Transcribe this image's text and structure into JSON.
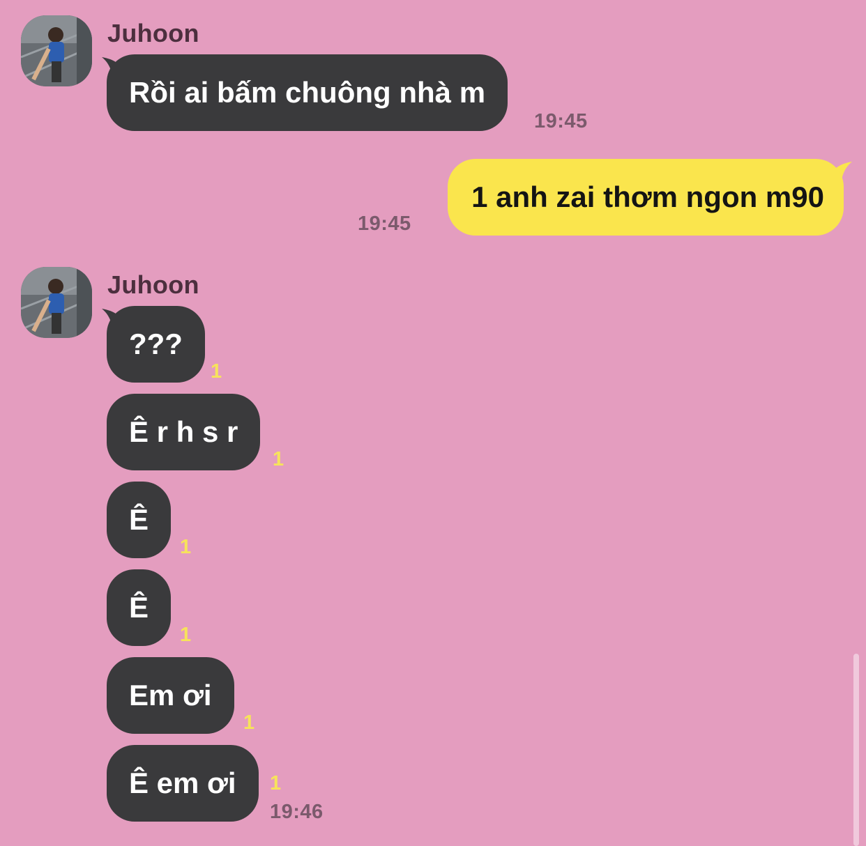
{
  "chat": {
    "contact_name": "Juhoon",
    "messages": [
      {
        "direction": "in",
        "text": "Rồi ai bấm chuông nhà m",
        "time": "19:45"
      },
      {
        "direction": "out",
        "text": "1 anh zai thơm ngon m90",
        "time": "19:45"
      },
      {
        "direction": "in",
        "text": "???",
        "unread": "1"
      },
      {
        "direction": "in",
        "text": "Ê r h s r",
        "unread": "1"
      },
      {
        "direction": "in",
        "text": "Ê",
        "unread": "1"
      },
      {
        "direction": "in",
        "text": "Ê",
        "unread": "1"
      },
      {
        "direction": "in",
        "text": "Em ơi",
        "unread": "1"
      },
      {
        "direction": "in",
        "text": "Ê em ơi",
        "unread": "1",
        "time": "19:46"
      }
    ]
  },
  "theme": {
    "background": "#e49dbf",
    "incoming_bubble": "#3a3a3c",
    "outgoing_bubble": "#fae54d",
    "unread_color": "#f7e35b"
  }
}
